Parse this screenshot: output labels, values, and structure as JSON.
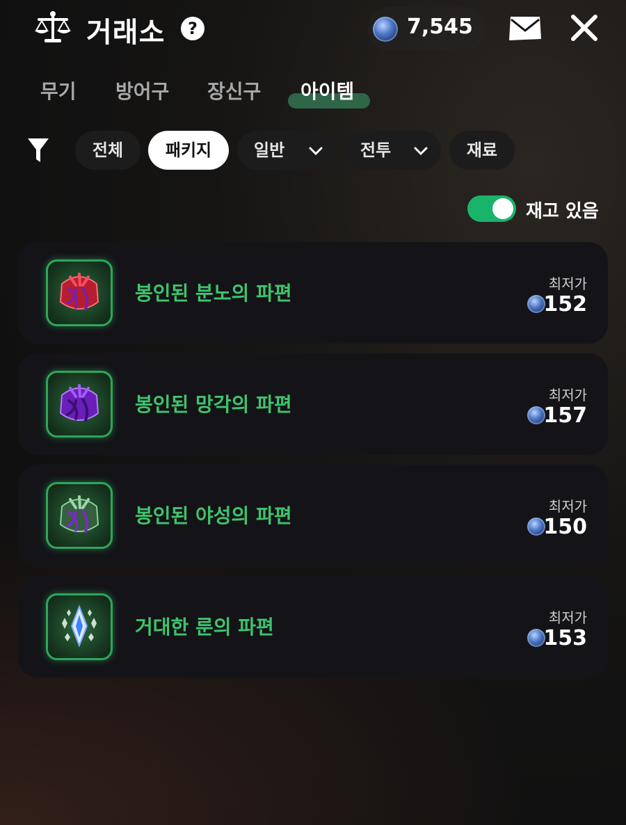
{
  "header": {
    "title": "거래소",
    "help_symbol": "?",
    "currency_icon": "blue-coin-icon",
    "balance": "7,545"
  },
  "tabs": [
    {
      "label": "무기",
      "active": false
    },
    {
      "label": "방어구",
      "active": false
    },
    {
      "label": "장신구",
      "active": false
    },
    {
      "label": "아이템",
      "active": true
    }
  ],
  "filters": [
    {
      "label": "전체",
      "active": false,
      "dropdown": false
    },
    {
      "label": "패키지",
      "active": true,
      "dropdown": false
    },
    {
      "label": "일반",
      "active": false,
      "dropdown": true
    },
    {
      "label": "전투",
      "active": false,
      "dropdown": true
    },
    {
      "label": "재료",
      "active": false,
      "dropdown": false
    }
  ],
  "stock_toggle": {
    "label": "재고 있음",
    "on": true
  },
  "items": [
    {
      "name": "봉인된 분노의 파편",
      "price_label": "최저가",
      "price": "152",
      "icon": "red-shard-icon",
      "color": "#c62a3a"
    },
    {
      "name": "봉인된 망각의 파편",
      "price_label": "최저가",
      "price": "157",
      "icon": "purple-shard-icon",
      "color": "#7a2ac6"
    },
    {
      "name": "봉인된 야성의 파편",
      "price_label": "최저가",
      "price": "150",
      "icon": "green-shard-icon",
      "color": "#3f6a46"
    },
    {
      "name": "거대한 룬의 파편",
      "price_label": "최저가",
      "price": "153",
      "icon": "rune-crystal-icon",
      "color": "#4aa0ff"
    }
  ],
  "colors": {
    "accent_green": "#3fc46c",
    "toggle_green": "#19b46a"
  }
}
